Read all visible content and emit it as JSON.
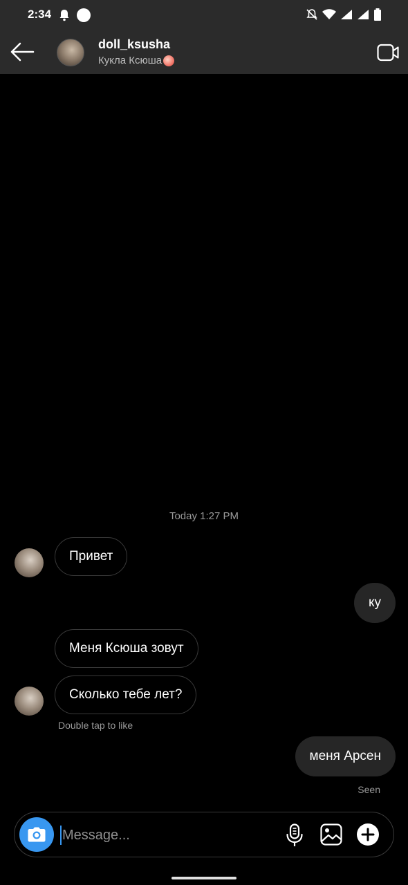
{
  "status_bar": {
    "time": "2:34"
  },
  "header": {
    "username": "doll_ksusha",
    "display_name": "Кукла Ксюша",
    "display_name_emoji": "peach-emoji"
  },
  "chat": {
    "timestamp": "Today 1:27 PM",
    "messages": [
      {
        "from": "them",
        "text": "Привет"
      },
      {
        "from": "me",
        "text": "ку"
      },
      {
        "from": "them",
        "text": "Меня Ксюша зовут"
      },
      {
        "from": "them",
        "text": "Сколько тебе лет?"
      },
      {
        "from": "me",
        "text": "меня Арсен"
      }
    ],
    "double_tap_hint": "Double tap to like",
    "seen_label": "Seen"
  },
  "composer": {
    "placeholder": "Message..."
  },
  "colors": {
    "accent": "#3897f0",
    "header_bg": "#2b2b2b",
    "outgoing_bubble": "#262626"
  }
}
